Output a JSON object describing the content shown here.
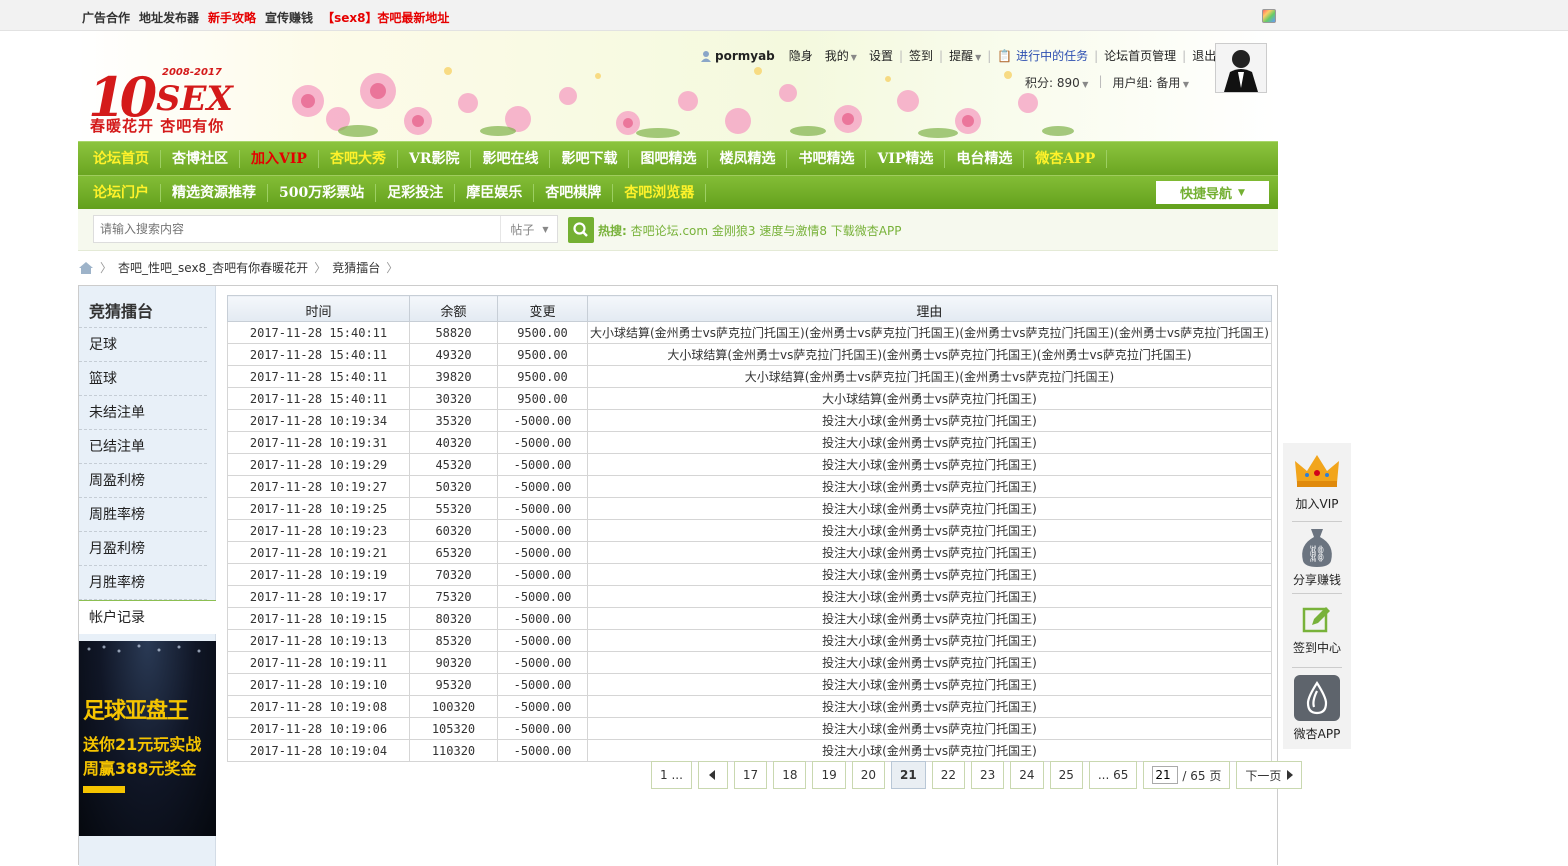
{
  "topbar": {
    "links": [
      {
        "label": "广告合作",
        "red": false
      },
      {
        "label": "地址发布器",
        "red": false
      },
      {
        "label": "新手攻略",
        "red": true
      },
      {
        "label": "宣传赚钱",
        "red": false
      },
      {
        "label": "【sex8】杏吧最新地址",
        "red": true
      }
    ]
  },
  "logo": {
    "years": "2008-2017",
    "slogan": "春暖花开 杏吧有你",
    "ten": "10",
    "sex": "SEX"
  },
  "user": {
    "name": "pormyab",
    "items": [
      "隐身",
      "我的",
      "设置",
      "签到",
      "提醒"
    ],
    "task": "进行中的任务",
    "manage": "论坛首页管理",
    "logout": "退出",
    "points": "积分: 890",
    "group": "用户组: 备用"
  },
  "nav1": [
    {
      "label": "论坛首页",
      "color": "yellow"
    },
    {
      "label": "杏博社区",
      "color": "white"
    },
    {
      "label": "加入VIP",
      "color": "red"
    },
    {
      "label": "杏吧大秀",
      "color": "yellow"
    },
    {
      "label": "VR影院",
      "color": "white"
    },
    {
      "label": "影吧在线",
      "color": "white"
    },
    {
      "label": "影吧下载",
      "color": "white"
    },
    {
      "label": "图吧精选",
      "color": "white"
    },
    {
      "label": "楼凤精选",
      "color": "white"
    },
    {
      "label": "书吧精选",
      "color": "white"
    },
    {
      "label": "VIP精选",
      "color": "white"
    },
    {
      "label": "电台精选",
      "color": "white"
    },
    {
      "label": "微杏APP",
      "color": "yellow"
    }
  ],
  "nav2": [
    {
      "label": "论坛门户",
      "color": "yellow"
    },
    {
      "label": "精选资源推荐",
      "color": "white"
    },
    {
      "label": "500万彩票站",
      "color": "white"
    },
    {
      "label": "足彩投注",
      "color": "white"
    },
    {
      "label": "摩臣娱乐",
      "color": "white"
    },
    {
      "label": "杏吧棋牌",
      "color": "white"
    },
    {
      "label": "杏吧浏览器",
      "color": "yellow"
    }
  ],
  "quicknav": "快捷导航",
  "search": {
    "placeholder": "请输入搜索内容",
    "type": "帖子",
    "hot_label": "热搜:",
    "hot_items": "杏吧论坛.com 金刚狼3 速度与激情8 下载微杏APP"
  },
  "breadcrumb": [
    "杏吧_性吧_sex8_杏吧有你春暖花开",
    "竞猜擂台"
  ],
  "sidebar": {
    "title": "竞猜擂台",
    "items": [
      "足球",
      "篮球",
      "未结注单",
      "已结注单",
      "周盈利榜",
      "周胜率榜",
      "月盈利榜",
      "月胜率榜",
      "帐户记录"
    ],
    "active": 8
  },
  "banner": {
    "line1": "足球亚盘王",
    "line2": "送你21元玩实战",
    "line3": "周赢388元奖金"
  },
  "table": {
    "headers": [
      "时间",
      "余额",
      "变更",
      "理由"
    ],
    "rows": [
      [
        "2017-11-28 15:40:11",
        "58820",
        "9500.00",
        "大小球结算(金州勇士vs萨克拉门托国王)(金州勇士vs萨克拉门托国王)(金州勇士vs萨克拉门托国王)(金州勇士vs萨克拉门托国王)"
      ],
      [
        "2017-11-28 15:40:11",
        "49320",
        "9500.00",
        "大小球结算(金州勇士vs萨克拉门托国王)(金州勇士vs萨克拉门托国王)(金州勇士vs萨克拉门托国王)"
      ],
      [
        "2017-11-28 15:40:11",
        "39820",
        "9500.00",
        "大小球结算(金州勇士vs萨克拉门托国王)(金州勇士vs萨克拉门托国王)"
      ],
      [
        "2017-11-28 15:40:11",
        "30320",
        "9500.00",
        "大小球结算(金州勇士vs萨克拉门托国王)"
      ],
      [
        "2017-11-28 10:19:34",
        "35320",
        "-5000.00",
        "投注大小球(金州勇士vs萨克拉门托国王)"
      ],
      [
        "2017-11-28 10:19:31",
        "40320",
        "-5000.00",
        "投注大小球(金州勇士vs萨克拉门托国王)"
      ],
      [
        "2017-11-28 10:19:29",
        "45320",
        "-5000.00",
        "投注大小球(金州勇士vs萨克拉门托国王)"
      ],
      [
        "2017-11-28 10:19:27",
        "50320",
        "-5000.00",
        "投注大小球(金州勇士vs萨克拉门托国王)"
      ],
      [
        "2017-11-28 10:19:25",
        "55320",
        "-5000.00",
        "投注大小球(金州勇士vs萨克拉门托国王)"
      ],
      [
        "2017-11-28 10:19:23",
        "60320",
        "-5000.00",
        "投注大小球(金州勇士vs萨克拉门托国王)"
      ],
      [
        "2017-11-28 10:19:21",
        "65320",
        "-5000.00",
        "投注大小球(金州勇士vs萨克拉门托国王)"
      ],
      [
        "2017-11-28 10:19:19",
        "70320",
        "-5000.00",
        "投注大小球(金州勇士vs萨克拉门托国王)"
      ],
      [
        "2017-11-28 10:19:17",
        "75320",
        "-5000.00",
        "投注大小球(金州勇士vs萨克拉门托国王)"
      ],
      [
        "2017-11-28 10:19:15",
        "80320",
        "-5000.00",
        "投注大小球(金州勇士vs萨克拉门托国王)"
      ],
      [
        "2017-11-28 10:19:13",
        "85320",
        "-5000.00",
        "投注大小球(金州勇士vs萨克拉门托国王)"
      ],
      [
        "2017-11-28 10:19:11",
        "90320",
        "-5000.00",
        "投注大小球(金州勇士vs萨克拉门托国王)"
      ],
      [
        "2017-11-28 10:19:10",
        "95320",
        "-5000.00",
        "投注大小球(金州勇士vs萨克拉门托国王)"
      ],
      [
        "2017-11-28 10:19:08",
        "100320",
        "-5000.00",
        "投注大小球(金州勇士vs萨克拉门托国王)"
      ],
      [
        "2017-11-28 10:19:06",
        "105320",
        "-5000.00",
        "投注大小球(金州勇士vs萨克拉门托国王)"
      ],
      [
        "2017-11-28 10:19:04",
        "110320",
        "-5000.00",
        "投注大小球(金州勇士vs萨克拉门托国王)"
      ]
    ]
  },
  "pager": {
    "first": "1 ...",
    "pages": [
      "17",
      "18",
      "19",
      "20",
      "21",
      "22",
      "23",
      "24",
      "25"
    ],
    "current": "21",
    "last": "... 65",
    "jump_value": "21",
    "total": "/ 65 页",
    "next": "下一页"
  },
  "floatbar": [
    "加入VIP",
    "分享赚钱",
    "签到中心",
    "微杏APP"
  ],
  "colors": {
    "nav_green": "#74b032",
    "accent_red": "#e60000",
    "yellow": "#fff22a"
  }
}
